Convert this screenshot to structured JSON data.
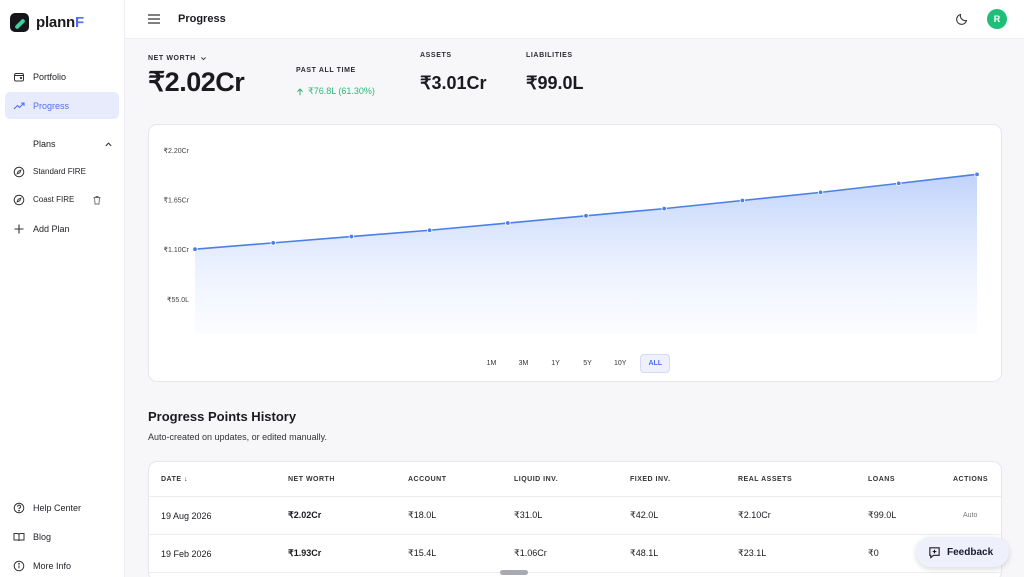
{
  "brand": {
    "name_prefix": "plann",
    "name_accent": "F",
    "accent_color": "#4f6ff0"
  },
  "sidebar": {
    "items": [
      {
        "label": "Portfolio",
        "icon": "wallet-icon"
      },
      {
        "label": "Progress",
        "icon": "trend-up-icon",
        "active": true
      }
    ],
    "plans_label": "Plans",
    "plans": [
      {
        "label": "Standard FIRE",
        "icon": "compass-icon"
      },
      {
        "label": "Coast FIRE",
        "icon": "compass-icon",
        "deletable": true
      }
    ],
    "add_plan": "Add Plan",
    "footer": [
      {
        "label": "Help Center",
        "icon": "help-circle-icon"
      },
      {
        "label": "Blog",
        "icon": "book-icon"
      },
      {
        "label": "More Info",
        "icon": "info-icon"
      }
    ]
  },
  "topbar": {
    "title": "Progress",
    "avatar_initial": "R",
    "avatar_color": "#1fbf7a"
  },
  "summary": {
    "net_worth_label": "NET WORTH",
    "net_worth": "₹2.02Cr",
    "past_label": "PAST ALL TIME",
    "change": "₹76.8L (61.30%)",
    "assets_label": "ASSETS",
    "assets": "₹3.01Cr",
    "liabilities_label": "LIABILITIES",
    "liabilities": "₹99.0L",
    "positive_color": "#2fb874"
  },
  "chart_data": {
    "type": "area",
    "x": [
      1,
      2,
      3,
      4,
      5,
      6,
      7,
      8,
      9,
      10,
      11
    ],
    "values": [
      1.1,
      1.17,
      1.24,
      1.31,
      1.39,
      1.47,
      1.55,
      1.64,
      1.73,
      1.83,
      1.93
    ],
    "y_unit": "Cr",
    "ylim": [
      0.3,
      2.2
    ],
    "y_ticks": [
      {
        "value": 2.2,
        "label": "₹2.20Cr"
      },
      {
        "value": 1.65,
        "label": "₹1.65Cr"
      },
      {
        "value": 1.1,
        "label": "₹1.10Cr"
      },
      {
        "value": 0.55,
        "label": "₹55.0L"
      }
    ],
    "grid": false,
    "line_color": "#4a7fe6"
  },
  "ranges": {
    "options": [
      "1M",
      "3M",
      "1Y",
      "5Y",
      "10Y",
      "ALL"
    ],
    "active": "ALL"
  },
  "history": {
    "title": "Progress Points History",
    "subtitle": "Auto-created on updates, or edited manually.",
    "columns": [
      "DATE ↓",
      "NET WORTH",
      "ACCOUNT",
      "LIQUID INV.",
      "FIXED INV.",
      "REAL ASSETS",
      "LOANS",
      "ACTIONS"
    ],
    "rows": [
      [
        "19 Aug 2026",
        "₹2.02Cr",
        "₹18.0L",
        "₹31.0L",
        "₹42.0L",
        "₹2.10Cr",
        "₹99.0L",
        "Auto"
      ],
      [
        "19 Feb 2026",
        "₹1.93Cr",
        "₹15.4L",
        "₹1.06Cr",
        "₹48.1L",
        "₹23.1L",
        "₹0",
        ""
      ]
    ]
  },
  "feedback_label": "Feedback"
}
